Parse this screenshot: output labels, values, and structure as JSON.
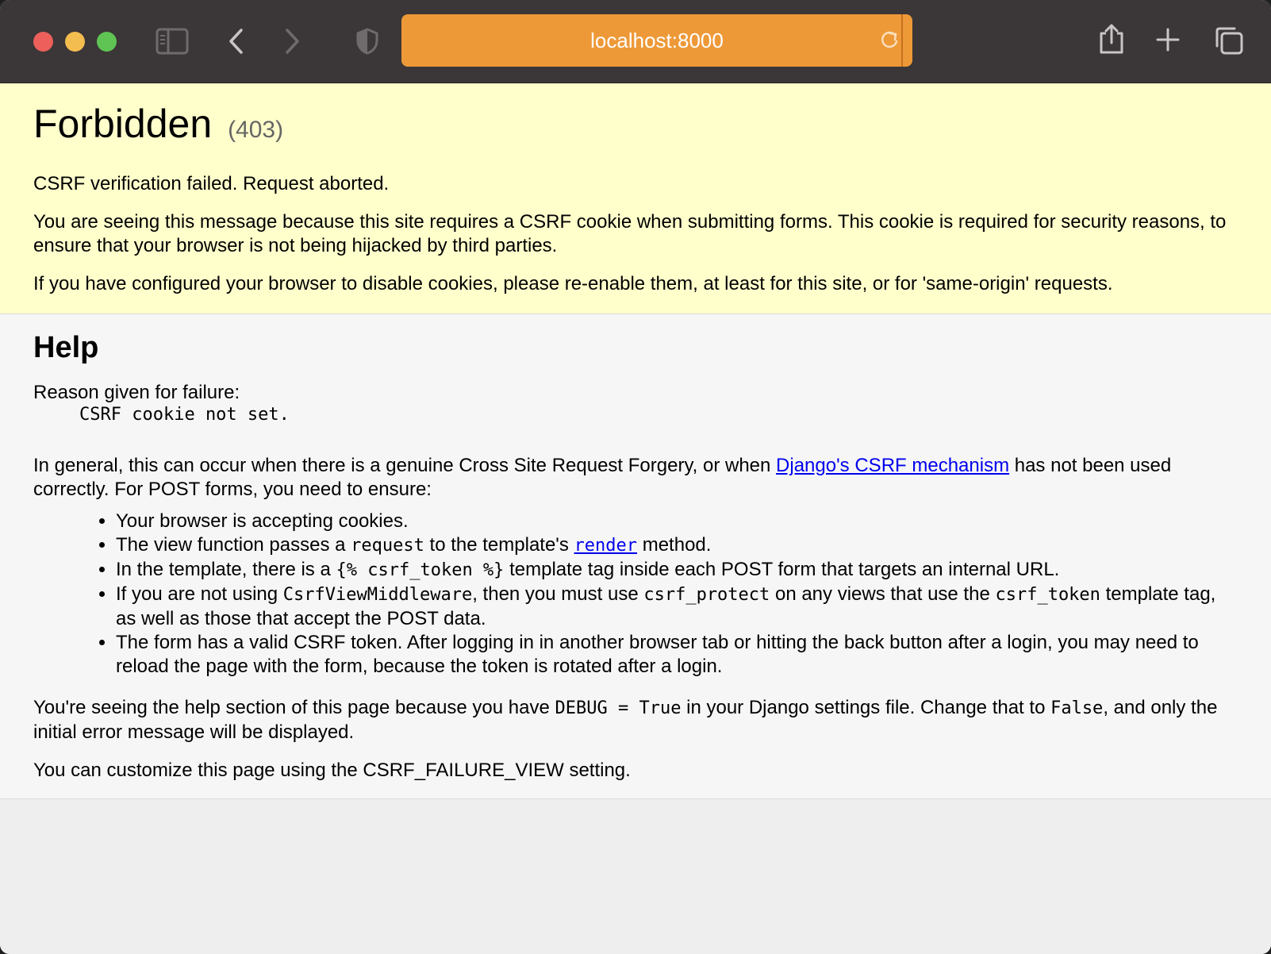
{
  "browser": {
    "url": "localhost:8000"
  },
  "summary": {
    "title": "Forbidden",
    "status_code": "(403)",
    "message": "CSRF verification failed. Request aborted.",
    "para1": "You are seeing this message because this site requires a CSRF cookie when submitting forms. This cookie is required for security reasons, to ensure that your browser is not being hijacked by third parties.",
    "para2": "If you have configured your browser to disable cookies, please re-enable them, at least for this site, or for 'same-origin' requests."
  },
  "help": {
    "heading": "Help",
    "reason_label": "Reason given for failure:",
    "reason": "CSRF cookie not set.",
    "general_pre": "In general, this can occur when there is a genuine Cross Site Request Forgery, or when ",
    "csrf_link": "Django's CSRF mechanism",
    "general_post": " has not been used correctly. For POST forms, you need to ensure:",
    "items": {
      "i1": "Your browser is accepting cookies.",
      "i2_a": "The view function passes a ",
      "i2_code": "request",
      "i2_b": " to the template's ",
      "i2_link": "render",
      "i2_c": " method.",
      "i3_a": "In the template, there is a ",
      "i3_code": "{% csrf_token %}",
      "i3_b": " template tag inside each POST form that targets an internal URL.",
      "i4_a": "If you are not using ",
      "i4_code1": "CsrfViewMiddleware",
      "i4_b": ", then you must use ",
      "i4_code2": "csrf_protect",
      "i4_c": " on any views that use the ",
      "i4_code3": "csrf_token",
      "i4_d": " template tag, as well as those that accept the POST data.",
      "i5": "The form has a valid CSRF token. After logging in in another browser tab or hitting the back button after a login, you may need to reload the page with the form, because the token is rotated after a login."
    },
    "debug_a": "You're seeing the help section of this page because you have ",
    "debug_code1": "DEBUG = True",
    "debug_b": " in your Django settings file. Change that to ",
    "debug_code2": "False",
    "debug_c": ", and only the initial error message will be displayed.",
    "customize": "You can customize this page using the CSRF_FAILURE_VIEW setting."
  },
  "colors": {
    "url_bar": "#ee9938",
    "summary_bg": "#ffffcc",
    "link": "#0000ee"
  }
}
